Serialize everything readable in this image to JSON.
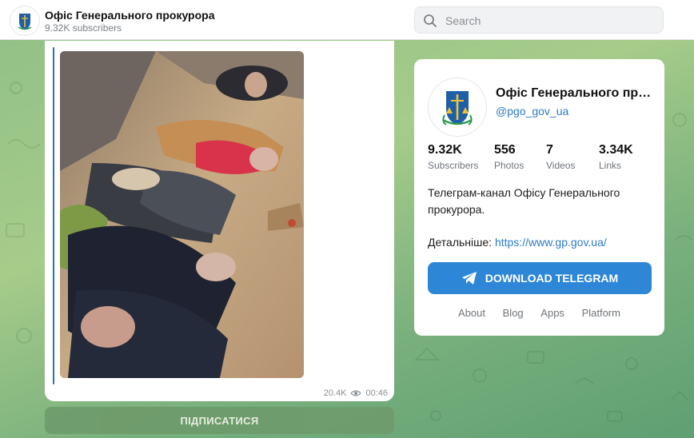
{
  "header": {
    "channel_title": "Офіс Генерального прокурора",
    "subscribers": "9.32K subscribers",
    "search_placeholder": "Search"
  },
  "message": {
    "views": "20.4K",
    "time": "00:46"
  },
  "subscribe_label": "ПІДПИСАТИСЯ",
  "card": {
    "name": "Офіс Генерального прокурора",
    "handle": "@pgo_gov_ua",
    "stats": [
      {
        "value": "9.32K",
        "label": "Subscribers"
      },
      {
        "value": "556",
        "label": "Photos"
      },
      {
        "value": "7",
        "label": "Videos"
      },
      {
        "value": "3.34K",
        "label": "Links"
      }
    ],
    "description": "Телеграм-канал Офісу Генерального прокурора.",
    "details_label": "Детальніше:",
    "details_link": "https://www.gp.gov.ua/",
    "download_label": "DOWNLOAD TELEGRAM",
    "footer_links": [
      "About",
      "Blog",
      "Apps",
      "Platform"
    ]
  },
  "colors": {
    "accent": "#2e86d6",
    "link": "#2e7cc4",
    "message_bar": "#2b6fbd",
    "background": "#8fbf86"
  }
}
